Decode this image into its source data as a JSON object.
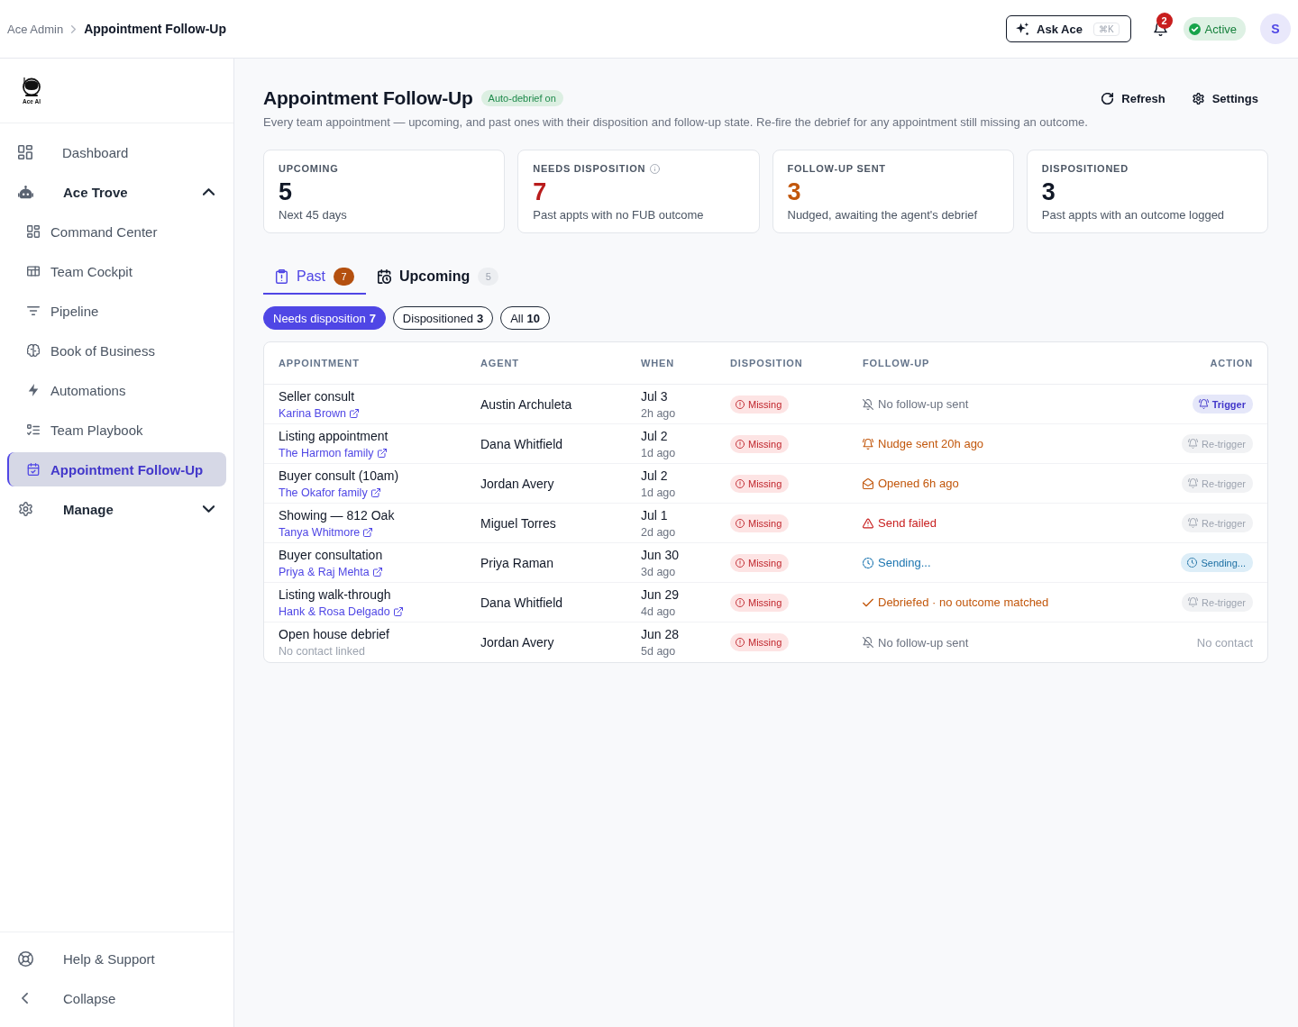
{
  "breadcrumb": [
    {
      "label": "Ace Admin"
    },
    {
      "label": "Appointment Follow-Up"
    }
  ],
  "topbar": {
    "ask": {
      "label": "Ask Ace",
      "shortcut": "⌘K"
    },
    "notifications": {
      "count": "2"
    },
    "status": {
      "label": "Active"
    },
    "avatar": {
      "initial": "S"
    }
  },
  "sidebar": {
    "logo": {
      "text": "Ace AI"
    },
    "items": [
      {
        "kind": "link",
        "label": "Dashboard",
        "selected": false
      },
      {
        "kind": "group",
        "label": "Ace Trove",
        "selected": false,
        "expanded": true,
        "children": [
          {
            "label": "Command Center",
            "selected": false
          },
          {
            "label": "Team Cockpit",
            "selected": false
          },
          {
            "label": "Pipeline",
            "selected": false
          },
          {
            "label": "Book of Business",
            "selected": false
          },
          {
            "label": "Automations",
            "selected": false
          },
          {
            "label": "Team Playbook",
            "selected": false
          },
          {
            "label": "Appointment Follow-Up",
            "selected": true
          }
        ]
      },
      {
        "kind": "group",
        "label": "Manage",
        "selected": false,
        "expanded": false
      }
    ],
    "footer": [
      {
        "label": "Help & Support"
      },
      {
        "label": "Collapse"
      }
    ]
  },
  "header": {
    "title": "Appointment Follow-Up",
    "badge": "Auto-debrief on",
    "description": "Every team appointment — upcoming, and past ones with their disposition and follow-up state. Re-fire the debrief for any appointment still missing an outcome.",
    "actions": [
      {
        "label": "Refresh"
      },
      {
        "label": "Settings"
      }
    ]
  },
  "stats": [
    {
      "label": "UPCOMING",
      "value": "5",
      "caption": "Next 45 days",
      "color": "#111827"
    },
    {
      "label": "NEEDS DISPOSITION",
      "has_info": true,
      "value": "7",
      "caption": "Past appts with no FUB outcome",
      "color": "#b91c1c"
    },
    {
      "label": "FOLLOW-UP SENT",
      "value": "3",
      "caption": "Nudged, awaiting the agent's debrief",
      "color": "#c2570c"
    },
    {
      "label": "DISPOSITIONED",
      "value": "3",
      "caption": "Past appts with an outcome logged",
      "color": "#111827"
    }
  ],
  "tabs": [
    {
      "label": "Past",
      "count": "7",
      "selected": true
    },
    {
      "label": "Upcoming",
      "count": "5",
      "selected": false
    }
  ],
  "filters": [
    {
      "label": "Needs disposition",
      "count": "7",
      "selected": true
    },
    {
      "label": "Dispositioned",
      "count": "3",
      "selected": false
    },
    {
      "label": "All",
      "count": "10",
      "selected": false
    }
  ],
  "table": {
    "columns": [
      "APPOINTMENT",
      "AGENT",
      "WHEN",
      "DISPOSITION",
      "FOLLOW-UP",
      "ACTION"
    ],
    "rows": [
      {
        "title": "Seller consult",
        "contact": {
          "kind": "link",
          "name": "Karina Brown"
        },
        "agent": "Austin Archuleta",
        "date": "Jul 3",
        "ago": "2h ago",
        "disposition": {
          "kind": "missing",
          "label": "Missing"
        },
        "followup": {
          "kind": "none",
          "label": "No follow-up sent"
        },
        "action": {
          "kind": "trigger",
          "label": "Trigger"
        }
      },
      {
        "title": "Listing appointment",
        "contact": {
          "kind": "link",
          "name": "The Harmon family"
        },
        "agent": "Dana Whitfield",
        "date": "Jul 2",
        "ago": "1d ago",
        "disposition": {
          "kind": "missing",
          "label": "Missing"
        },
        "followup": {
          "kind": "nudged",
          "label": "Nudge sent 20h ago"
        },
        "action": {
          "kind": "retrigger",
          "label": "Re-trigger"
        }
      },
      {
        "title": "Buyer consult (10am)",
        "contact": {
          "kind": "link",
          "name": "The Okafor family"
        },
        "agent": "Jordan Avery",
        "date": "Jul 2",
        "ago": "1d ago",
        "disposition": {
          "kind": "missing",
          "label": "Missing"
        },
        "followup": {
          "kind": "opened",
          "label": "Opened 6h ago"
        },
        "action": {
          "kind": "retrigger",
          "label": "Re-trigger"
        }
      },
      {
        "title": "Showing — 812 Oak",
        "contact": {
          "kind": "link",
          "name": "Tanya Whitmore"
        },
        "agent": "Miguel Torres",
        "date": "Jul 1",
        "ago": "2d ago",
        "disposition": {
          "kind": "missing",
          "label": "Missing"
        },
        "followup": {
          "kind": "failed",
          "label": "Send failed"
        },
        "action": {
          "kind": "retrigger",
          "label": "Re-trigger"
        }
      },
      {
        "title": "Buyer consultation",
        "contact": {
          "kind": "link",
          "name": "Priya & Raj Mehta"
        },
        "agent": "Priya Raman",
        "date": "Jun 30",
        "ago": "3d ago",
        "disposition": {
          "kind": "missing",
          "label": "Missing"
        },
        "followup": {
          "kind": "sending",
          "label": "Sending..."
        },
        "action": {
          "kind": "sending",
          "label": "Sending..."
        }
      },
      {
        "title": "Listing walk-through",
        "contact": {
          "kind": "link",
          "name": "Hank & Rosa Delgado"
        },
        "agent": "Dana Whitfield",
        "date": "Jun 29",
        "ago": "4d ago",
        "disposition": {
          "kind": "missing",
          "label": "Missing"
        },
        "followup": {
          "kind": "debriefed",
          "label": "Debriefed · no outcome matched"
        },
        "action": {
          "kind": "retrigger",
          "label": "Re-trigger"
        }
      },
      {
        "title": "Open house debrief",
        "contact": {
          "kind": "none",
          "name": "No contact linked"
        },
        "agent": "Jordan Avery",
        "date": "Jun 28",
        "ago": "5d ago",
        "disposition": {
          "kind": "missing",
          "label": "Missing"
        },
        "followup": {
          "kind": "none",
          "label": "No follow-up sent"
        },
        "action": {
          "kind": "none",
          "label": "No contact"
        }
      }
    ]
  }
}
